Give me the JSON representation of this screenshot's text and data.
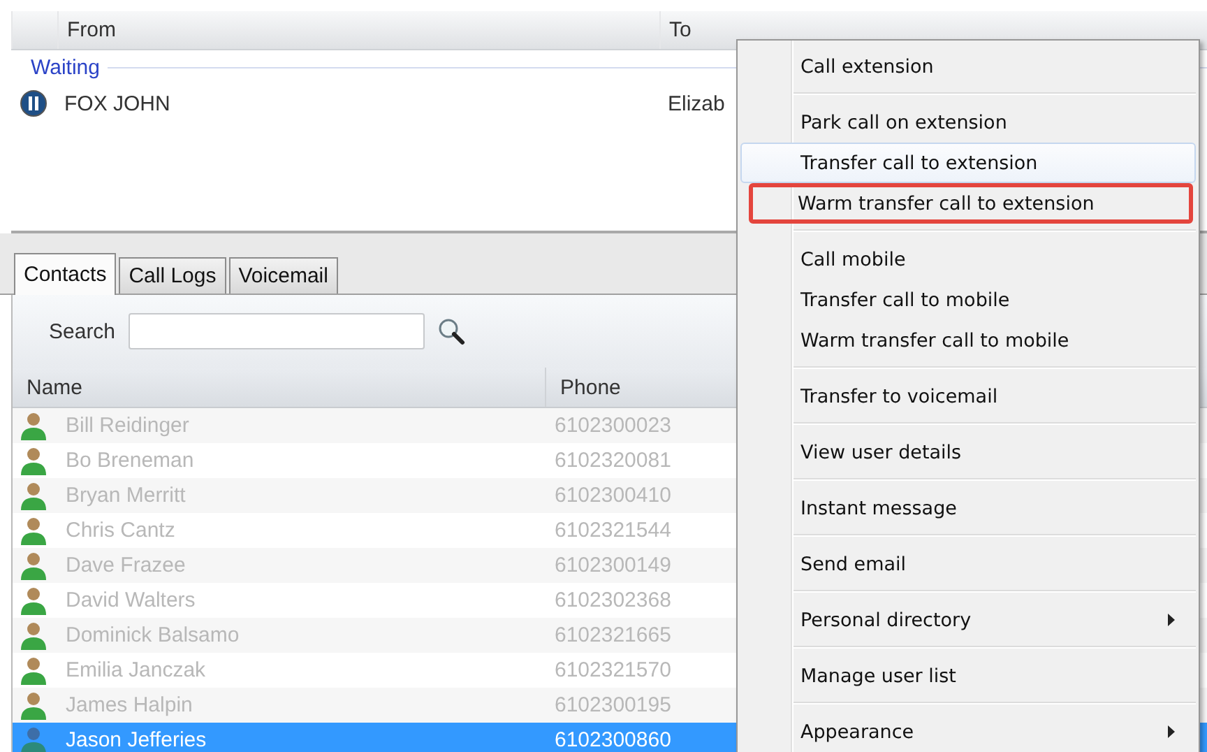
{
  "calls": {
    "columns": [
      "From",
      "To"
    ],
    "groups": [
      {
        "label": "Waiting",
        "rows": [
          {
            "from": "FOX JOHN",
            "to": "Elizab",
            "on_hold": true
          }
        ]
      }
    ]
  },
  "tabs": [
    {
      "label": "Contacts",
      "selected": true
    },
    {
      "label": "Call Logs",
      "selected": false
    },
    {
      "label": "Voicemail",
      "selected": false
    }
  ],
  "search": {
    "label": "Search"
  },
  "contacts": {
    "columns": [
      "Name",
      "Phone"
    ],
    "rows": [
      {
        "name": "Bill Reidinger",
        "phone": "6102300023",
        "selected": false
      },
      {
        "name": "Bo Breneman",
        "phone": "6102320081",
        "selected": false
      },
      {
        "name": "Bryan Merritt",
        "phone": "6102300410",
        "selected": false
      },
      {
        "name": "Chris Cantz",
        "phone": "6102321544",
        "selected": false
      },
      {
        "name": "Dave Frazee",
        "phone": "6102300149",
        "selected": false
      },
      {
        "name": "David Walters",
        "phone": "6102302368",
        "selected": false
      },
      {
        "name": "Dominick Balsamo",
        "phone": "6102321665",
        "selected": false
      },
      {
        "name": "Emilia Janczak",
        "phone": "6102321570",
        "selected": false
      },
      {
        "name": "James Halpin",
        "phone": "6102300195",
        "selected": false
      },
      {
        "name": "Jason Jefferies",
        "phone": "6102300860",
        "selected": true
      }
    ]
  },
  "context_menu": {
    "groups": [
      [
        {
          "label": "Call extension",
          "hovered": false,
          "highlighted": false,
          "submenu": false
        }
      ],
      [
        {
          "label": "Park call on extension",
          "hovered": false,
          "highlighted": false,
          "submenu": false
        },
        {
          "label": "Transfer call to extension",
          "hovered": true,
          "highlighted": false,
          "submenu": false
        },
        {
          "label": "Warm transfer call to extension",
          "hovered": false,
          "highlighted": true,
          "submenu": false
        }
      ],
      [
        {
          "label": "Call mobile",
          "hovered": false,
          "highlighted": false,
          "submenu": false
        },
        {
          "label": "Transfer call to mobile",
          "hovered": false,
          "highlighted": false,
          "submenu": false
        },
        {
          "label": "Warm transfer call to mobile",
          "hovered": false,
          "highlighted": false,
          "submenu": false
        }
      ],
      [
        {
          "label": "Transfer to voicemail",
          "hovered": false,
          "highlighted": false,
          "submenu": false
        }
      ],
      [
        {
          "label": "View user details",
          "hovered": false,
          "highlighted": false,
          "submenu": false
        }
      ],
      [
        {
          "label": "Instant message",
          "hovered": false,
          "highlighted": false,
          "submenu": false
        }
      ],
      [
        {
          "label": "Send email",
          "hovered": false,
          "highlighted": false,
          "submenu": false
        }
      ],
      [
        {
          "label": "Personal directory",
          "hovered": false,
          "highlighted": false,
          "submenu": true
        }
      ],
      [
        {
          "label": "Manage user list",
          "hovered": false,
          "highlighted": false,
          "submenu": false
        }
      ],
      [
        {
          "label": "Appearance",
          "hovered": false,
          "highlighted": false,
          "submenu": true
        }
      ]
    ]
  }
}
